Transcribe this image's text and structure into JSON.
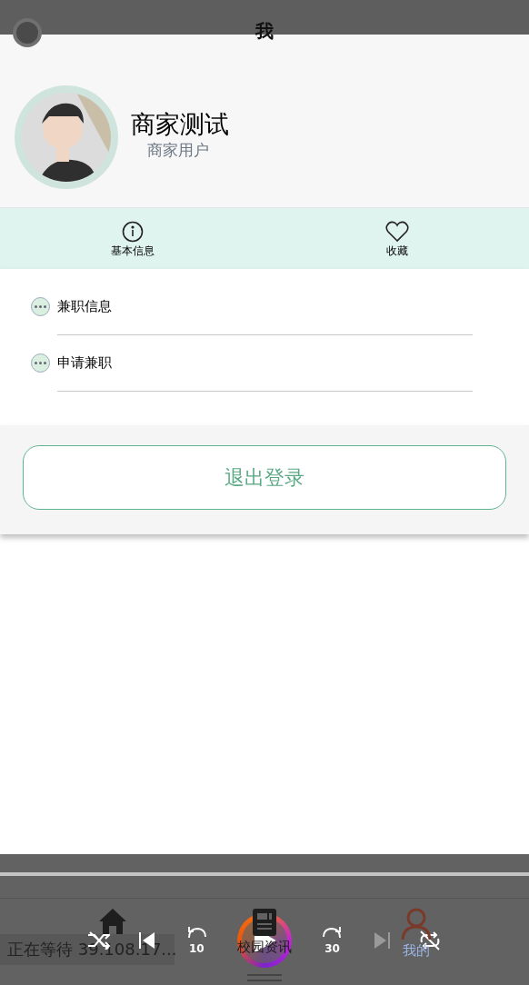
{
  "header": {
    "title": "我"
  },
  "profile": {
    "name": "商家测试",
    "role": "商家用户"
  },
  "shortcuts": [
    {
      "label": "基本信息",
      "kind": "info"
    },
    {
      "label": "收藏",
      "kind": "favorite"
    }
  ],
  "menu": [
    {
      "label": "兼职信息"
    },
    {
      "label": "申请兼职"
    }
  ],
  "logout": {
    "label": "退出登录"
  },
  "tab_bar": [
    {
      "kind": "home",
      "selected": false
    },
    {
      "kind": "news",
      "label": "校园资讯",
      "selected": false
    },
    {
      "kind": "profile",
      "label": "我的",
      "selected": true
    }
  ],
  "player": {
    "controls": [
      {
        "kind": "shuffle",
        "disabled": false
      },
      {
        "kind": "previous",
        "disabled": false
      },
      {
        "kind": "rewind",
        "label": "10",
        "disabled": false
      },
      {
        "kind": "play",
        "disabled": false
      },
      {
        "kind": "forward",
        "label": "30",
        "disabled": false
      },
      {
        "kind": "next",
        "disabled": true
      },
      {
        "kind": "repeat",
        "disabled": false
      }
    ]
  },
  "toast": {
    "text": "正在等待 39.108.17..."
  }
}
